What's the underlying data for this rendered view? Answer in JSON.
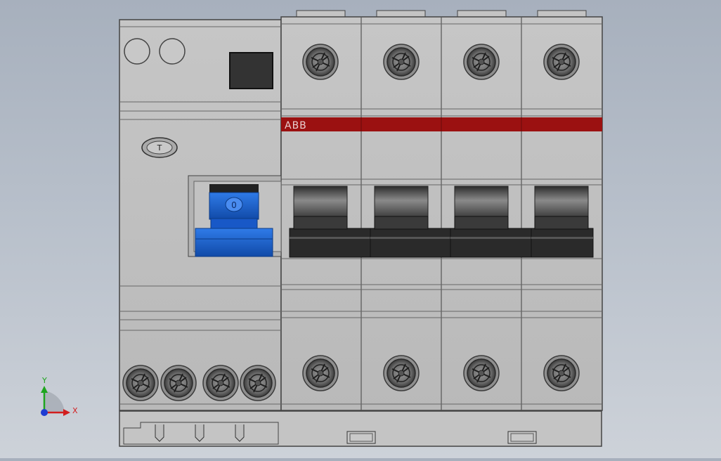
{
  "viewport": {
    "background_top": "#a7b0bd",
    "background_bottom": "#cdd2d9"
  },
  "device": {
    "brand": "ABB",
    "stripe_color": "#9b1111",
    "test_button_label": "T",
    "handle_label": "0",
    "handle_color": "#1e64d8",
    "body_color": "#bdbdbd",
    "poles": 4,
    "rcd_terminals": 4
  },
  "triad": {
    "x_label": "X",
    "y_label": "Y",
    "x_color": "#d21e1e",
    "y_color": "#1ea51e",
    "z_color": "#1e3cd2"
  }
}
